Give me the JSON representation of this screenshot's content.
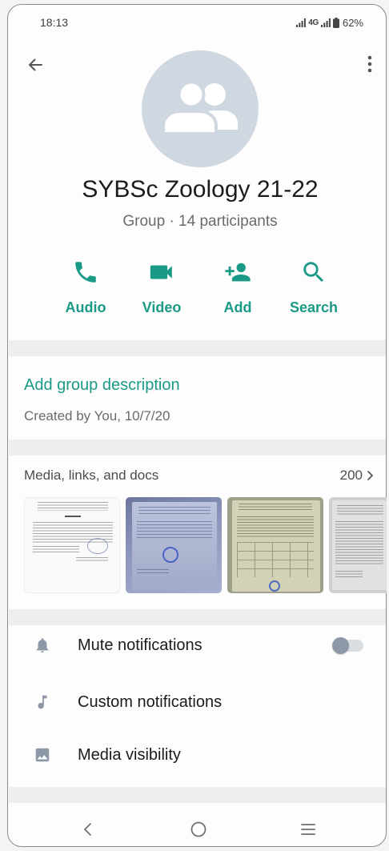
{
  "status_bar": {
    "time": "18:13",
    "network": "4G",
    "battery": "62%",
    "signal_icon": "signal-icon",
    "battery_icon": "battery-icon"
  },
  "header": {
    "back_icon": "arrow-left-icon",
    "menu_icon": "more-vertical-icon"
  },
  "group": {
    "avatar_icon": "group-icon",
    "name": "SYBSc Zoology 21-22",
    "subtitle": "Group · 14 participants"
  },
  "actions": [
    {
      "label": "Audio",
      "icon": "phone-icon"
    },
    {
      "label": "Video",
      "icon": "video-camera-icon"
    },
    {
      "label": "Add",
      "icon": "add-person-icon"
    },
    {
      "label": "Search",
      "icon": "search-icon"
    }
  ],
  "description": {
    "add_label": "Add group description",
    "created": "Created by You, 10/7/20"
  },
  "media": {
    "title": "Media, links, and docs",
    "count": "200",
    "chevron_icon": "chevron-right-icon"
  },
  "settings": [
    {
      "label": "Mute notifications",
      "icon": "bell-icon",
      "toggle_on": false
    },
    {
      "label": "Custom notifications",
      "icon": "music-note-icon"
    },
    {
      "label": "Media visibility",
      "icon": "image-icon"
    }
  ],
  "nav_bar": {
    "back_icon": "nav-back-icon",
    "home_icon": "nav-home-icon",
    "recents_icon": "nav-recents-icon"
  },
  "colors": {
    "accent": "#1a9a86",
    "avatar_bg": "#cfd7e1",
    "primary_text": "#1c1c1c",
    "secondary_text": "#6b6b6b",
    "icon_gray": "#8c98a5",
    "separator": "#eeeeee",
    "toggle_track": "#d9dee3"
  }
}
